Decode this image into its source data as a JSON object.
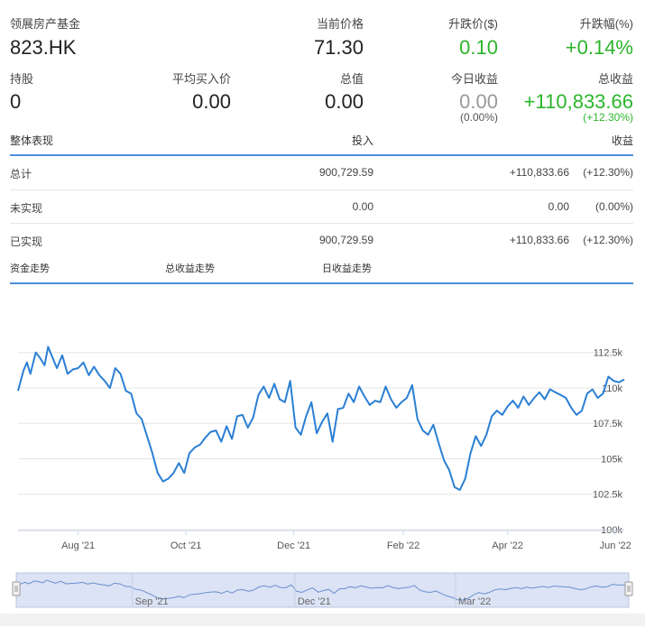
{
  "header": {
    "fund_name": "领展房产基金",
    "ticker": "823.HK",
    "price_label": "当前价格",
    "price_value": "71.30",
    "change_label": "升跌价($)",
    "change_value": "0.10",
    "change_pct_label": "升跌幅(%)",
    "change_pct_value": "+0.14%"
  },
  "holdings": {
    "shares_label": "持股",
    "shares_value": "0",
    "avg_cost_label": "平均买入价",
    "avg_cost_value": "0.00",
    "total_value_label": "总值",
    "total_value_value": "0.00",
    "today_gain_label": "今日收益",
    "today_gain_value": "0.00",
    "today_gain_pct": "(0.00%)",
    "total_gain_label": "总收益",
    "total_gain_value": "+110,833.66",
    "total_gain_pct": "(+12.30%)"
  },
  "table": {
    "headers": [
      "整体表现",
      "投入",
      "收益"
    ],
    "rows": [
      {
        "label": "总计",
        "invested": "900,729.59",
        "gain": "+110,833.66",
        "gain_pct": "(+12.30%)",
        "positive": true
      },
      {
        "label": "未实现",
        "invested": "0.00",
        "gain": "0.00",
        "gain_pct": "(0.00%)",
        "positive": false
      },
      {
        "label": "已实现",
        "invested": "900,729.59",
        "gain": "+110,833.66",
        "gain_pct": "(+12.30%)",
        "positive": true
      }
    ]
  },
  "tabs": [
    "资金走势",
    "总收益走势",
    "日收益走势"
  ],
  "colors": {
    "accent": "#4a90d9",
    "line": "#2b7fd4",
    "positive": "#2cb52c",
    "neutral": "#999999"
  },
  "chart_data": {
    "type": "line",
    "x": [
      "2021-06-28",
      "2021-07-01",
      "2021-07-03",
      "2021-07-05",
      "2021-07-08",
      "2021-07-10",
      "2021-07-13",
      "2021-07-15",
      "2021-07-18",
      "2021-07-20",
      "2021-07-23",
      "2021-07-26",
      "2021-07-29",
      "2021-08-01",
      "2021-08-04",
      "2021-08-07",
      "2021-08-10",
      "2021-08-13",
      "2021-08-16",
      "2021-08-19",
      "2021-08-22",
      "2021-08-25",
      "2021-08-28",
      "2021-08-31",
      "2021-09-03",
      "2021-09-06",
      "2021-09-09",
      "2021-09-12",
      "2021-09-15",
      "2021-09-18",
      "2021-09-21",
      "2021-09-24",
      "2021-09-27",
      "2021-09-30",
      "2021-10-03",
      "2021-10-06",
      "2021-10-09",
      "2021-10-12",
      "2021-10-15",
      "2021-10-18",
      "2021-10-21",
      "2021-10-24",
      "2021-10-27",
      "2021-10-30",
      "2021-11-02",
      "2021-11-05",
      "2021-11-08",
      "2021-11-11",
      "2021-11-14",
      "2021-11-17",
      "2021-11-20",
      "2021-11-23",
      "2021-11-26",
      "2021-11-29",
      "2021-12-02",
      "2021-12-05",
      "2021-12-08",
      "2021-12-11",
      "2021-12-14",
      "2021-12-17",
      "2021-12-20",
      "2021-12-23",
      "2021-12-26",
      "2021-12-29",
      "2022-01-01",
      "2022-01-04",
      "2022-01-07",
      "2022-01-10",
      "2022-01-13",
      "2022-01-16",
      "2022-01-19",
      "2022-01-22",
      "2022-01-25",
      "2022-01-28",
      "2022-01-31",
      "2022-02-03",
      "2022-02-06",
      "2022-02-09",
      "2022-02-12",
      "2022-02-15",
      "2022-02-18",
      "2022-02-21",
      "2022-02-24",
      "2022-02-27",
      "2022-03-02",
      "2022-03-05",
      "2022-03-08",
      "2022-03-11",
      "2022-03-14",
      "2022-03-17",
      "2022-03-20",
      "2022-03-23",
      "2022-03-26",
      "2022-03-29",
      "2022-04-01",
      "2022-04-04",
      "2022-04-07",
      "2022-04-10",
      "2022-04-13",
      "2022-04-16",
      "2022-04-19",
      "2022-04-22",
      "2022-04-25",
      "2022-04-28",
      "2022-05-01",
      "2022-05-04",
      "2022-05-07",
      "2022-05-10",
      "2022-05-13",
      "2022-05-16",
      "2022-05-19",
      "2022-05-22",
      "2022-05-25",
      "2022-05-28",
      "2022-05-31",
      "2022-06-03",
      "2022-06-06"
    ],
    "values": [
      109.8,
      111.2,
      111.8,
      111.0,
      112.5,
      112.2,
      111.6,
      112.9,
      112.0,
      111.4,
      112.3,
      111.0,
      111.3,
      111.4,
      111.8,
      110.9,
      111.5,
      110.9,
      110.5,
      110.0,
      111.4,
      111.0,
      109.8,
      109.6,
      108.2,
      107.8,
      106.6,
      105.4,
      104.0,
      103.4,
      103.6,
      104.0,
      104.7,
      104.0,
      105.4,
      105.8,
      106.0,
      106.5,
      106.9,
      107.0,
      106.2,
      107.3,
      106.4,
      108.0,
      108.1,
      107.2,
      107.9,
      109.5,
      110.1,
      109.3,
      110.3,
      109.2,
      109.0,
      110.5,
      107.2,
      106.7,
      108.0,
      109.0,
      106.8,
      107.6,
      108.2,
      106.2,
      108.5,
      108.6,
      109.6,
      109.0,
      110.1,
      109.4,
      108.8,
      109.1,
      109.0,
      110.1,
      109.2,
      108.6,
      109.0,
      109.3,
      110.2,
      107.8,
      107.0,
      106.7,
      107.4,
      106.1,
      104.9,
      104.2,
      103.0,
      102.8,
      103.6,
      105.4,
      106.6,
      105.9,
      106.7,
      108.0,
      108.4,
      108.1,
      108.7,
      109.1,
      108.6,
      109.4,
      108.8,
      109.3,
      109.7,
      109.2,
      109.9,
      109.7,
      109.5,
      109.3,
      108.6,
      108.1,
      108.4,
      109.6,
      109.9,
      109.3,
      109.6,
      110.8,
      110.5,
      110.4,
      110.6
    ],
    "tick_labels": [
      "Aug '21",
      "Oct '21",
      "Dec '21",
      "Feb '22",
      "Apr '22",
      "Jun '22"
    ],
    "tick_dates": [
      "2021-08-01",
      "2021-10-01",
      "2021-12-01",
      "2022-02-01",
      "2022-04-01",
      "2022-06-01"
    ],
    "y_tick_labels": [
      "100k",
      "102.5k",
      "105k",
      "107.5k",
      "110k",
      "112.5k"
    ],
    "y_tick_values": [
      100,
      102.5,
      105,
      107.5,
      110,
      112.5
    ],
    "ylim": [
      100,
      113.5
    ],
    "grid": true,
    "navigator_tick_labels": [
      "Sep '21",
      "Dec '21",
      "Mar '22"
    ],
    "navigator_tick_dates": [
      "2021-09-01",
      "2021-12-01",
      "2022-03-01"
    ]
  }
}
